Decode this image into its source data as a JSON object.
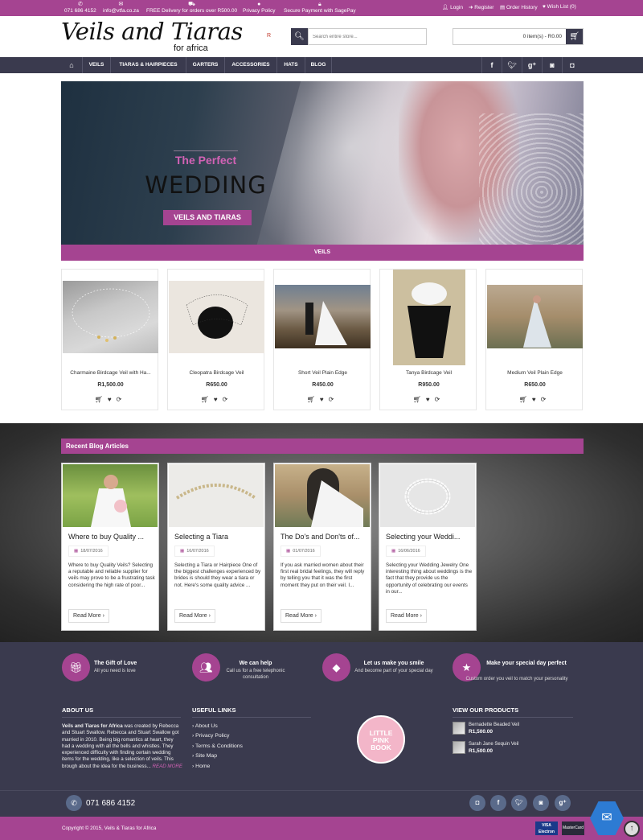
{
  "topbar": {
    "phone": "071 686 4152",
    "email": "info@vtfa.co.za",
    "delivery": "FREE Delivery for orders over R500.00",
    "privacy": "Privacy Policy",
    "secure": "Secure Payment with SagePay",
    "login": "Login",
    "register": "Register",
    "order_history": "Order History",
    "wish_list": "Wish List (0)"
  },
  "header": {
    "logo": "Veils and Tiaras",
    "logo_sub": "for africa",
    "r_mark": "R",
    "search_placeholder": "Search entire store...",
    "cart": "0 item(s) - R0.00"
  },
  "nav": {
    "items": [
      "VEILS",
      "TIARAS & HAIRPIECES",
      "GARTERS",
      "ACCESSORIES",
      "HATS",
      "BLOG"
    ]
  },
  "hero": {
    "line1": "The Perfect",
    "line2": "WEDDING",
    "button": "VEILS AND TIARAS",
    "section_bar": "VEILS"
  },
  "products": [
    {
      "name": "Charmaine Birdcage Veil with Ha...",
      "price": "R1,500.00"
    },
    {
      "name": "Cleopatra Birdcage Veil",
      "price": "R650.00"
    },
    {
      "name": "Short Veil Plain Edge",
      "price": "R450.00"
    },
    {
      "name": "Tanya Birdcage Veil",
      "price": "R950.00"
    },
    {
      "name": "Medium Veil Plain Edge",
      "price": "R650.00"
    }
  ],
  "blog": {
    "heading": "Recent Blog Articles",
    "read_more": "Read More",
    "articles": [
      {
        "title": "Where to buy Quality ...",
        "date": "18/07/2016",
        "excerpt": "Where to buy Quality Veils? Selecting a reputable and reliable supplier for veils may prove to be a frustrating task considering the high rate of poor..."
      },
      {
        "title": "Selecting a Tiara",
        "date": "16/07/2016",
        "excerpt": "Selecting a Tiara or Hairpiece One of the biggest challenges experienced by brides is should they wear a tiara or not. Here's some quality advice ..."
      },
      {
        "title": "The Do's and Don'ts of...",
        "date": "01/07/2016",
        "excerpt": "If you ask married women about their first real bridal feelings, they will reply by telling you that it was the first moment they put on their veil. I..."
      },
      {
        "title": "Selecting your Weddi...",
        "date": "16/06/2016",
        "excerpt": "Selecting your Wedding Jewelry One interesting thing about weddings is the fact that they provide us the opportunity of celebrating our events in our..."
      }
    ]
  },
  "features": [
    {
      "title": "The Gift of Love",
      "sub": "All you need is love"
    },
    {
      "title": "We can help",
      "sub": "Call us for a free telephonic consultation"
    },
    {
      "title": "Let us make you smile",
      "sub": "And become part of your special day"
    },
    {
      "title": "Make your special day perfect",
      "sub": "Custom order you veil to match your personality"
    }
  ],
  "footer": {
    "about_heading": "ABOUT US",
    "about_brand": "Veils and Tiaras for Africa",
    "about_text": " was created by Rebecca and Stuart Swallow. Rebecca and Stuart Swallow got married in 2010. Being big romantics at heart, they had a wedding with all the bells and whistles. They experienced difficulty with finding certain wedding items for the wedding, like a selection of veils. This brough about the idea for the business...",
    "read_more": "READ MORE",
    "links_heading": "USEFUL LINKS",
    "links": [
      "About Us",
      "Privacy Policy",
      "Terms & Conditions",
      "Site Map",
      "Home"
    ],
    "pinkbook": [
      "LITTLE",
      "PINK",
      "BOOK"
    ],
    "products_heading": "VIEW OUR PRODUCTS",
    "view_products": [
      {
        "name": "Bernadette Beaded Veil",
        "price": "R1,500.00"
      },
      {
        "name": "Sarah Jane Sequin Veil",
        "price": "R1,500.00"
      }
    ],
    "phone": "071 686 4152",
    "copyright": "Copyright © 2015, Veils & Tiaras for Africa",
    "visa": "VISA",
    "visa_sub": "Electron",
    "mastercard": "MasterCard"
  },
  "colors": {
    "accent": "#a54491",
    "dark": "#3a3a4e"
  },
  "icons": [
    "phone-icon",
    "mail-icon",
    "truck-icon",
    "privacy-icon",
    "lock-icon",
    "user-icon",
    "register-icon",
    "order-icon",
    "heart-icon",
    "search-icon",
    "cart-icon",
    "home-icon",
    "facebook-icon",
    "twitter-icon",
    "google-plus-icon",
    "stumble-icon",
    "instagram-icon",
    "gift-icon",
    "help-icon",
    "diamond-icon",
    "star-icon",
    "chat-icon",
    "scroll-top-icon"
  ]
}
